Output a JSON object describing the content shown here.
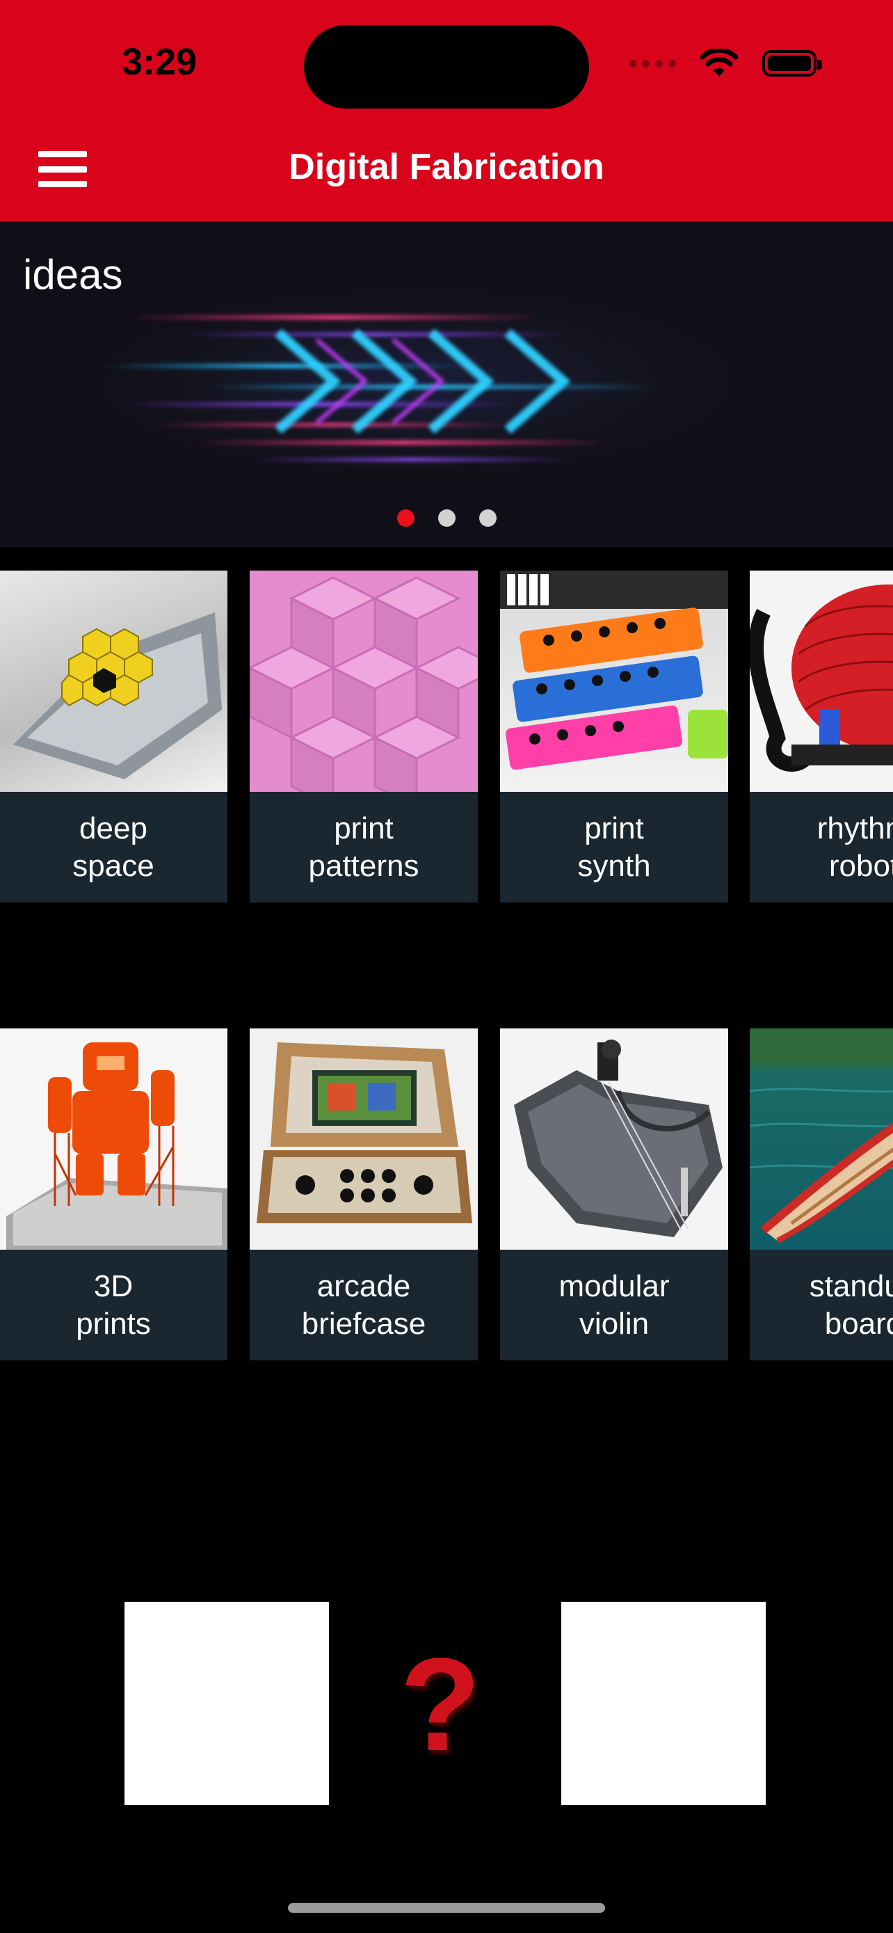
{
  "status_bar": {
    "time": "3:29"
  },
  "nav": {
    "title": "Digital Fabrication",
    "menu_icon": "hamburger-menu-icon"
  },
  "banner": {
    "label": "ideas",
    "pages": 3,
    "active_page": 1
  },
  "rows": [
    {
      "cards": [
        {
          "caption": "deep\nspace"
        },
        {
          "caption": "print\npatterns"
        },
        {
          "caption": "print\nsynth"
        },
        {
          "caption": "rhythm\nrobot"
        }
      ]
    },
    {
      "cards": [
        {
          "caption": "3D\nprints"
        },
        {
          "caption": "arcade\nbriefcase"
        },
        {
          "caption": "modular\nviolin"
        },
        {
          "caption": "standup\nboard"
        }
      ]
    }
  ],
  "bottom": {
    "center_icon": "question-mark-icon",
    "center_glyph": "?"
  },
  "colors": {
    "brand_red": "#d9041b",
    "card_caption_bg": "#1a2630",
    "dot_active": "#e8101a"
  }
}
